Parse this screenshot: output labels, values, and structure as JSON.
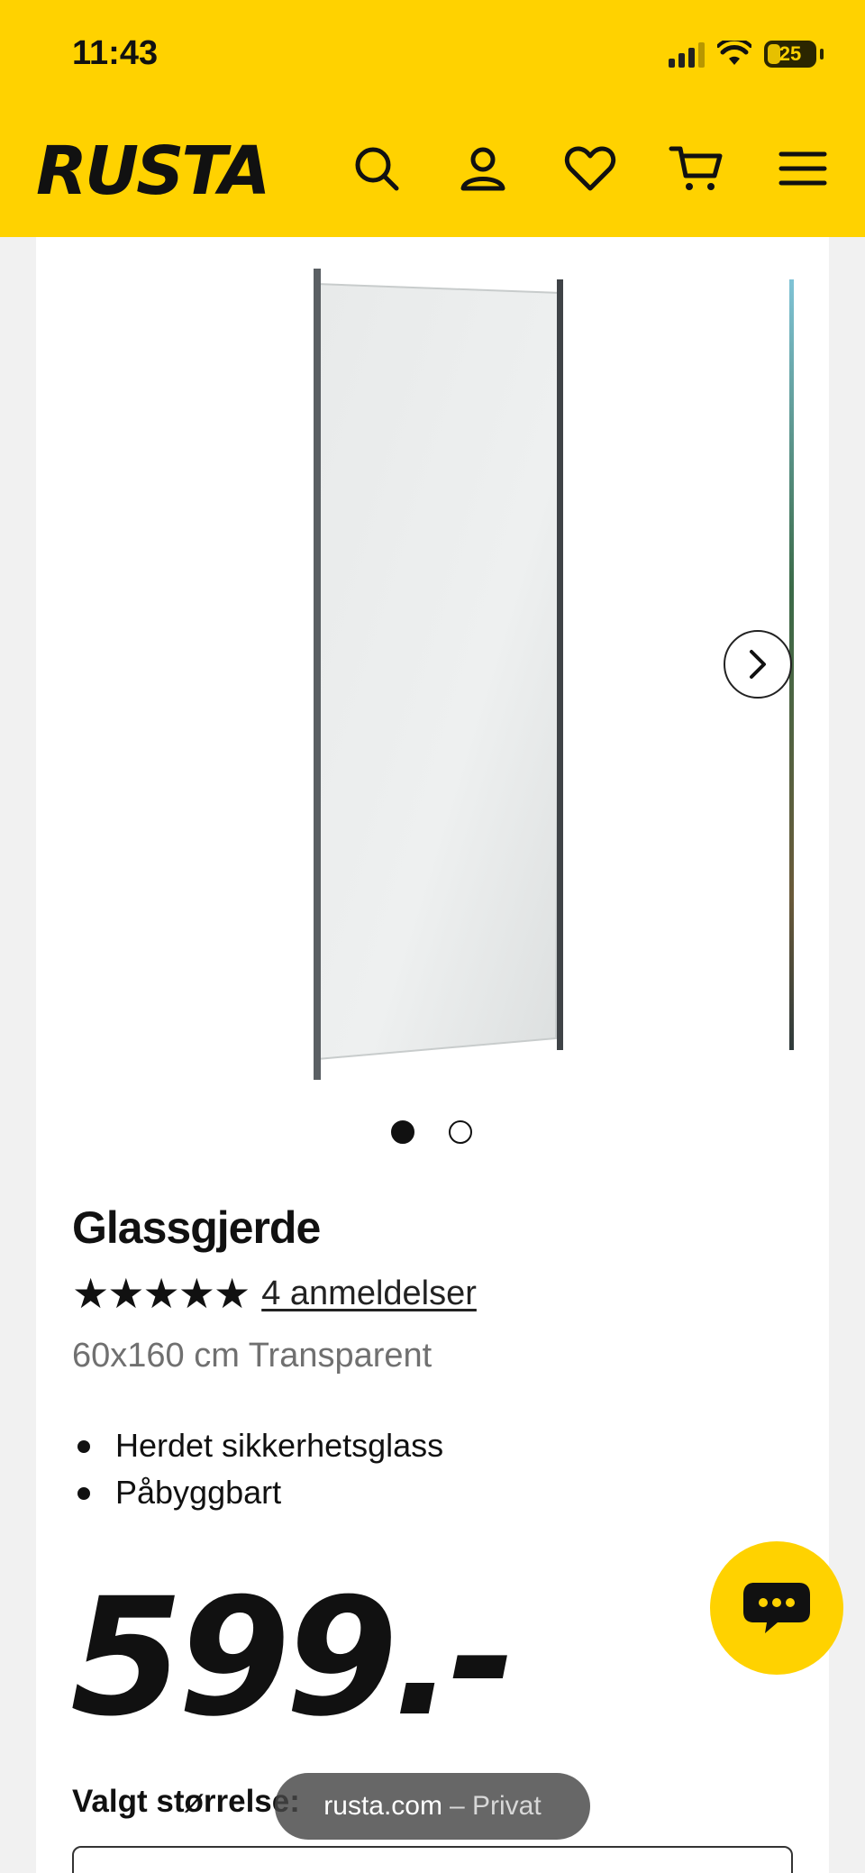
{
  "status_bar": {
    "time": "11:43",
    "battery": "25"
  },
  "header": {
    "logo": "RUSTA",
    "icons": [
      "search-icon",
      "account-icon",
      "heart-icon",
      "cart-icon",
      "menu-icon"
    ],
    "background": "#ffd200"
  },
  "carousel": {
    "slide_count": 2,
    "active_index": 0
  },
  "product": {
    "title": "Glassgjerde",
    "stars": "★★★★★",
    "rating": 5,
    "reviews_link": "4 anmeldelser",
    "variant": "60x160 cm Transparent",
    "features": [
      "Herdet sikkerhetsglass",
      "Påbyggbart"
    ],
    "price": "599.-"
  },
  "size_section": {
    "label": "Valgt størrelse: "
  },
  "browser": {
    "domain": "rusta.com",
    "mode": "– Privat"
  },
  "colors": {
    "brand_yellow": "#ffd200",
    "text": "#111111",
    "muted": "#707070"
  }
}
